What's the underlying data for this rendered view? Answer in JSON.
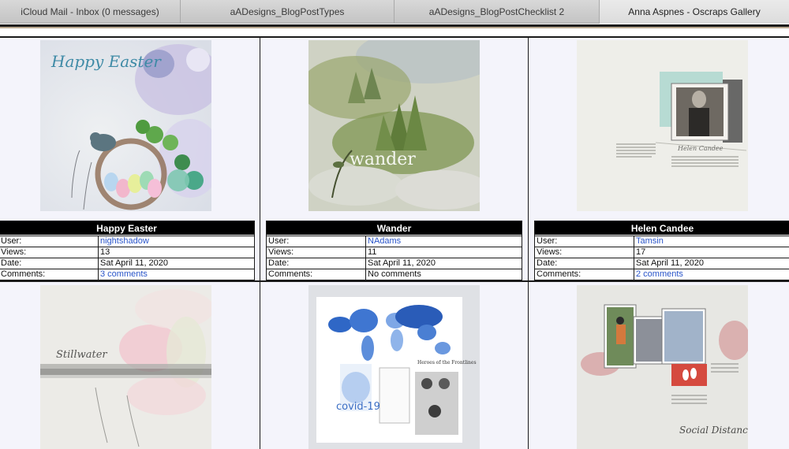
{
  "tabs": [
    {
      "label": "iCloud Mail - Inbox (0 messages)"
    },
    {
      "label": "aADesigns_BlogPostTypes"
    },
    {
      "label": "aADesigns_BlogPostChecklist 2"
    },
    {
      "label": "Anna Aspnes - Oscraps Gallery"
    }
  ],
  "labels": {
    "user": "User:",
    "views": "Views:",
    "date": "Date:",
    "comments": "Comments:"
  },
  "gallery": [
    {
      "title": "Happy Easter",
      "user": "nightshadow",
      "views": "13",
      "date": "Sat April 11, 2020",
      "comments": "3 comments",
      "image_text": "Happy Easter"
    },
    {
      "title": "Wander",
      "user": "NAdams",
      "views": "11",
      "date": "Sat April 11, 2020",
      "comments": "No comments",
      "image_text": "wander"
    },
    {
      "title": "Helen Candee",
      "user": "Tamsin",
      "views": "17",
      "date": "Sat April 11, 2020",
      "comments": "2 comments",
      "image_text": "Helen Candee"
    }
  ],
  "row2": [
    {
      "image_text": "Stillwater"
    },
    {
      "image_text": "covid-19",
      "image_text_2": "Heroes of the Frontlines"
    },
    {
      "image_text": "Social Distancing"
    }
  ],
  "colors": {
    "link": "#2a55c9",
    "title_bar": "#000000"
  }
}
